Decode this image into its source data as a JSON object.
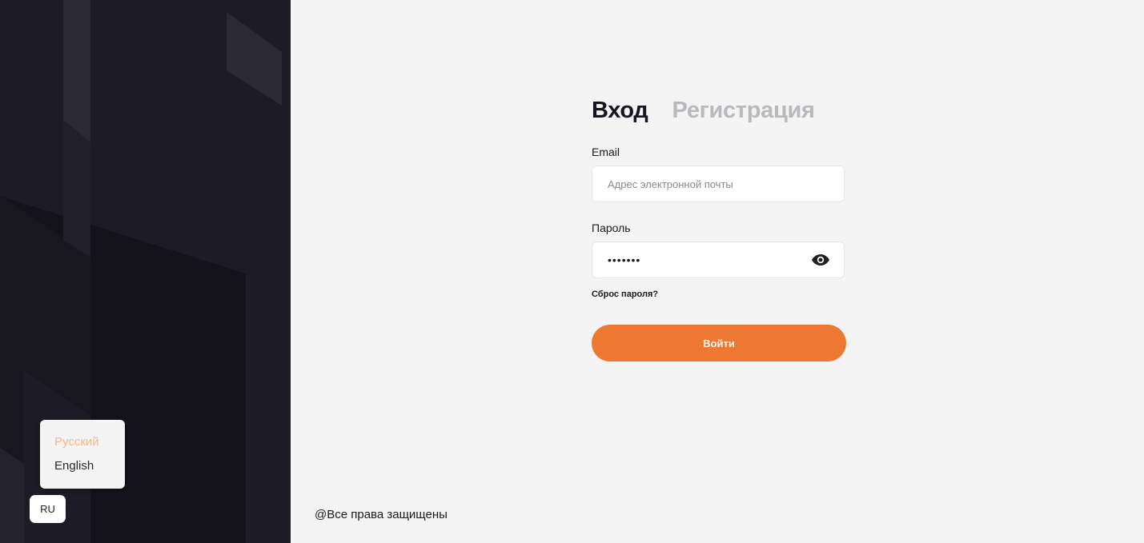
{
  "sidebar": {
    "language_menu": {
      "options": [
        "Русский",
        "English"
      ],
      "selected_index": 0
    },
    "language_button_label": "RU"
  },
  "auth": {
    "tabs": [
      {
        "label": "Вход",
        "active": true
      },
      {
        "label": "Регистрация",
        "active": false
      }
    ],
    "email": {
      "label": "Email",
      "placeholder": "Адрес электронной почты",
      "value": ""
    },
    "password": {
      "label": "Пароль",
      "value": "•••••••",
      "toggle_icon": "eye-icon"
    },
    "reset_link": "Сброс пароля?",
    "submit_label": "Войти"
  },
  "footer": {
    "copyright": "@Все права защищены"
  },
  "colors": {
    "accent": "#ee7831",
    "sidebar_bg": "#14131c",
    "page_bg": "#f4f4f4",
    "active_language": "#f4b98a"
  }
}
